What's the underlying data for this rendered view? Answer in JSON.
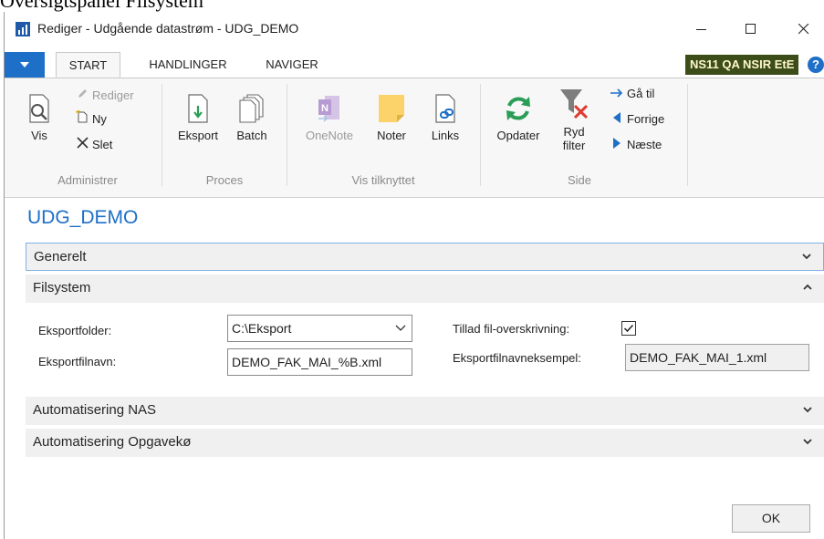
{
  "background_text": "Oversigtspanel Filsystem",
  "window": {
    "title": "Rediger - Udgående datastrøm - UDG_DEMO",
    "controls": [
      "minimize-icon",
      "maximize-icon",
      "close-icon"
    ]
  },
  "ribbon": {
    "tabs": [
      {
        "label": "START",
        "active": true
      },
      {
        "label": "HANDLINGER",
        "active": false
      },
      {
        "label": "NAVIGER",
        "active": false
      }
    ],
    "company": "NS11 QA NSIR EtE",
    "help": "?",
    "groups": {
      "administrer": {
        "label": "Administrer",
        "vis": "Vis",
        "rediger": "Rediger",
        "ny": "Ny",
        "slet": "Slet"
      },
      "proces": {
        "label": "Proces",
        "eksport": "Eksport",
        "batch": "Batch"
      },
      "vis_tilknyttet": {
        "label": "Vis tilknyttet",
        "onenote": "OneNote",
        "noter": "Noter",
        "links": "Links"
      },
      "side": {
        "label": "Side",
        "opdater": "Opdater",
        "ryd_filter_1": "Ryd",
        "ryd_filter_2": "filter",
        "gaa_til": "Gå til",
        "forrige": "Forrige",
        "naeste": "Næste"
      }
    }
  },
  "page": {
    "title": "UDG_DEMO",
    "fasttabs": {
      "generelt": "Generelt",
      "filsystem": "Filsystem",
      "nas": "Automatisering NAS",
      "opgavekoe": "Automatisering Opgavekø"
    },
    "filsystem": {
      "eksportfolder_label": "Eksportfolder:",
      "eksportfolder_value": "C:\\Eksport",
      "eksportfilnavn_label": "Eksportfilnavn:",
      "eksportfilnavn_value": "DEMO_FAK_MAI_%B.xml",
      "overskrivning_label": "Tillad fil-overskrivning:",
      "overskrivning_checked": true,
      "eksempel_label": "Eksportfilnavneksempel:",
      "eksempel_value": "DEMO_FAK_MAI_1.xml"
    },
    "ok_label": "OK"
  },
  "colors": {
    "accent": "#1e6fc7",
    "company_bg": "#3c4d1a",
    "company_fg": "#fff8c8",
    "ribbon_bg": "#f7f7f7",
    "fasttab_bg": "#f0f0f0"
  }
}
